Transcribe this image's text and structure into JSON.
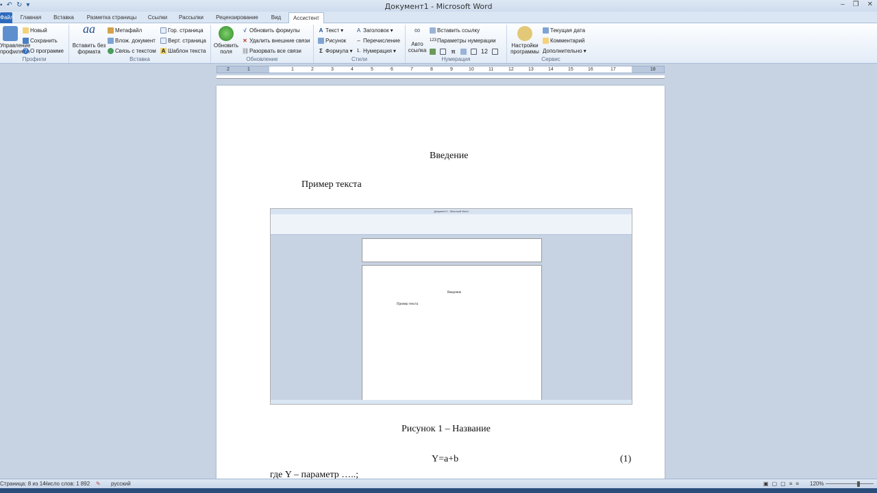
{
  "window": {
    "title": "Документ1 - Microsoft Word"
  },
  "tabs": [
    "Файл",
    "Главная",
    "Вставка",
    "Разметка страницы",
    "Ссылки",
    "Рассылки",
    "Рецензирование",
    "Вид",
    "Ассистент"
  ],
  "ribbon": {
    "profiles": {
      "label": "Профили",
      "big": "Управление профилями",
      "items": [
        "Новый",
        "Сохранить",
        "О программе"
      ]
    },
    "insert": {
      "label": "Вставка",
      "big": "Вставить без формата",
      "col1": [
        "Метафайл",
        "Влож. документ",
        "Связь с текстом"
      ],
      "col2": [
        "Гор. страница",
        "Верт. страница",
        "Шаблон текста"
      ]
    },
    "update": {
      "label": "Обновление",
      "big": "Обновить поля",
      "items": [
        "Обновить формулы",
        "Удалить внешние связи",
        "Разорвать все связи"
      ]
    },
    "styles": {
      "label": "Стили",
      "col1": [
        "Текст",
        "Рисунок",
        "Формула"
      ],
      "col2": [
        "Заголовок",
        "Перечисление",
        "Нумерация"
      ]
    },
    "numbering": {
      "label": "Нумерация",
      "big": "Авто ссылка",
      "items": [
        "Вставить ссылку",
        "Параметры нумерации"
      ],
      "num": "12"
    },
    "service": {
      "label": "Сервис",
      "big": "Настройки программы",
      "items": [
        "Текущая дата",
        "Комментарий",
        "Дополнительно"
      ]
    }
  },
  "ruler": {
    "ticks": [
      "2",
      "1",
      "1",
      "2",
      "3",
      "4",
      "5",
      "6",
      "7",
      "8",
      "9",
      "10",
      "11",
      "12",
      "13",
      "14",
      "15",
      "16",
      "17",
      "18"
    ]
  },
  "document": {
    "heading": "Введение",
    "paragraph": "Пример текста",
    "figure_caption": "Рисунок 1 – Название",
    "formula": "Y=a+b",
    "formula_number": "(1)",
    "where_line": "где   Y – параметр …..;"
  },
  "figure": {
    "title": "Документ1 - Microsoft Word",
    "heading": "Введение",
    "paragraph": "Пример текста"
  },
  "status": {
    "page": "Страница: 8 из 14",
    "words": "Число слов: 1 892",
    "lang": "русский",
    "zoom": "120%"
  }
}
